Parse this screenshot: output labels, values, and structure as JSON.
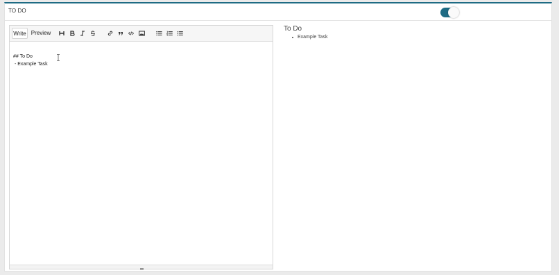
{
  "panel": {
    "title": "TO DO",
    "accent_color": "#1e6b84",
    "toggle": {
      "state": "on",
      "color": "#1e6b84"
    }
  },
  "editor": {
    "tabs": {
      "write": "Write",
      "preview": "Preview",
      "active": "Write"
    },
    "toolbar_icons": [
      "heading-icon",
      "bold-icon",
      "italic-icon",
      "strikethrough-icon",
      "link-icon",
      "quote-icon",
      "code-icon",
      "image-icon",
      "unordered-list-icon",
      "ordered-list-icon",
      "task-list-icon"
    ],
    "content": {
      "line1": "## To Do",
      "line2": " - Example Task"
    }
  },
  "preview": {
    "heading": "To Do",
    "items": [
      "Example Task"
    ]
  }
}
